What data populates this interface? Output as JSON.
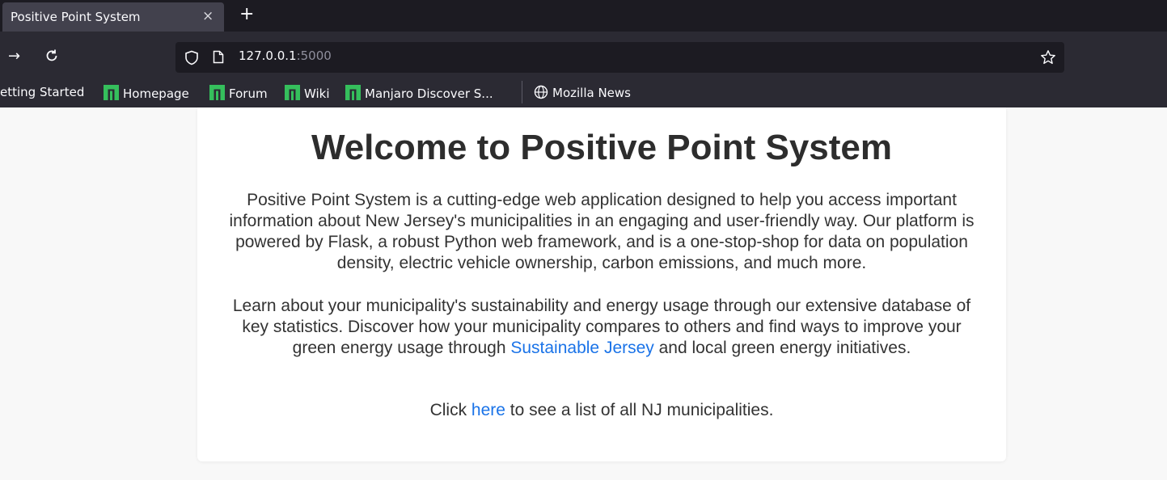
{
  "browser": {
    "tab_title": "Positive Point System",
    "tab_close": "×",
    "new_tab": "+",
    "url_host": "127.0.0.1",
    "url_port": ":5000"
  },
  "bookmarks": [
    {
      "label": "etting Started"
    },
    {
      "label": "Homepage"
    },
    {
      "label": "Forum"
    },
    {
      "label": "Wiki"
    },
    {
      "label": "Manjaro Discover S..."
    },
    {
      "label": "Mozilla News"
    }
  ],
  "page": {
    "heading": "Welcome to Positive Point System",
    "p1": "Positive Point System is a cutting-edge web application designed to help you access important information about New Jersey's municipalities in an engaging and user-friendly way. Our platform is powered by Flask, a robust Python web framework, and is a one-stop-shop for data on population density, electric vehicle ownership, carbon emissions, and much more.",
    "p2_before": "Learn about your municipality's sustainability and energy usage through our extensive database of key statistics. Discover how your municipality compares to others and find ways to improve your green energy usage through ",
    "p2_link": "Sustainable Jersey",
    "p2_after": " and local green energy initiatives.",
    "p3_before": "Click ",
    "p3_link": "here",
    "p3_after": " to see a list of all NJ municipalities."
  },
  "colors": {
    "link": "#1a73e8",
    "manjaro_icon": "#35bf5c"
  }
}
